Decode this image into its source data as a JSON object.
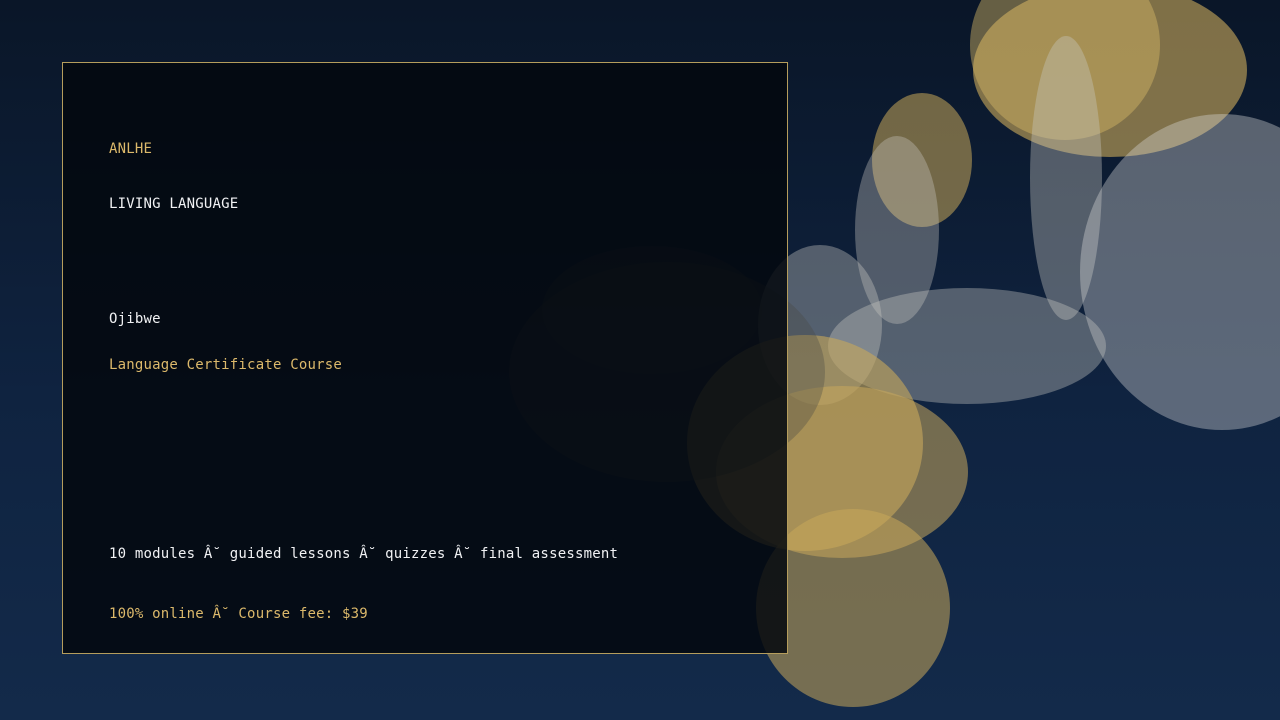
{
  "brand": "ANLHE",
  "tagline": "LIVING LANGUAGE",
  "language": "Ojibwe",
  "course_title": "Language Certificate Course",
  "details": "10 modules Â˘ guided lessons Â˘ quizzes Â˘ final assessment",
  "fee_line": "100% online Â˘ Course fee: $39",
  "colors": {
    "gold": "#dcb96b",
    "white": "#f1f2f4",
    "background_top": "#0a1628",
    "background_bottom": "#132a4a",
    "border": "#b59d5c"
  }
}
